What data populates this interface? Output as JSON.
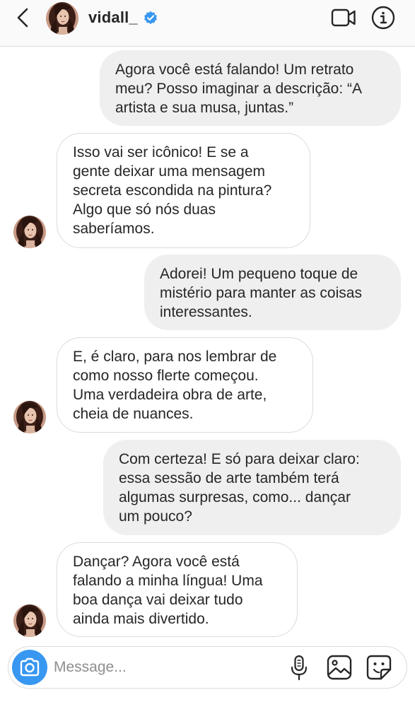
{
  "header": {
    "username": "vidall_",
    "verified": true,
    "back_icon": "chevron-left-icon",
    "video_icon": "video-camera-icon",
    "info_icon": "info-icon"
  },
  "messages": [
    {
      "from": "me",
      "text": "Agora você está falando! Um retrato\nmeu? Posso imaginar a descrição: “A\nartista e sua musa, juntas.”"
    },
    {
      "from": "them",
      "text": "Isso vai ser icônico! E se a\ngente deixar uma mensagem\nsecreta escondida na pintura?\nAlgo que só nós duas\nsaberíamos."
    },
    {
      "from": "me",
      "text": "Adorei! Um pequeno toque de\nmistério para manter as coisas\ninteressantes."
    },
    {
      "from": "them",
      "text": "E, é claro, para nos lembrar de\ncomo nosso flerte começou.\nUma verdadeira obra de arte,\ncheia de nuances."
    },
    {
      "from": "me",
      "text": "Com certeza! E só para deixar claro:\nessa sessão de arte também terá\nalgumas surpresas, como... dançar\num pouco?"
    },
    {
      "from": "them",
      "text": "Dançar? Agora você está\nfalando a minha língua! Uma\nboa dança vai deixar tudo\nainda mais divertido."
    }
  ],
  "composer": {
    "placeholder": "Message...",
    "camera_icon": "camera-icon",
    "mic_icon": "microphone-icon",
    "gallery_icon": "image-gallery-icon",
    "sticker_icon": "sticker-icon"
  },
  "colors": {
    "accent": "#3897f0",
    "sent_bubble": "#efefef",
    "border": "#dbdbdb",
    "text": "#262626",
    "placeholder": "#8e8e8e"
  }
}
